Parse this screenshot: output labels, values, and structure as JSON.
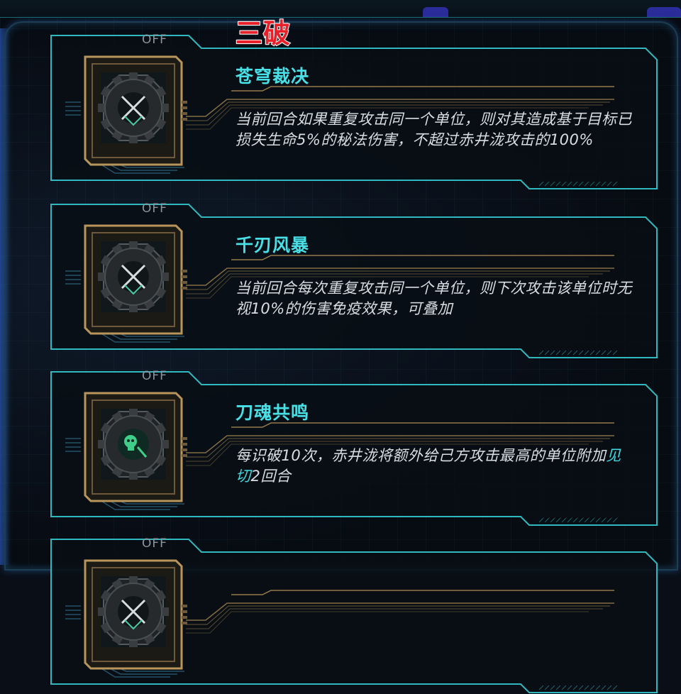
{
  "headline": "三破",
  "skills": [
    {
      "state": "OFF",
      "title": "苍穹裁决",
      "desc": "当前回合如果重复攻击同一个单位，则对其造成基于目标已损失生命5%的秘法伤害，不超过赤井泷攻击的100%",
      "icon": "crossed-swords-gear-icon"
    },
    {
      "state": "OFF",
      "title": "千刃风暴",
      "desc": "当前回合每次重复攻击同一个单位，则下次攻击该单位时无视10%的伤害免疫效果，可叠加",
      "icon": "crossed-swords-gear-icon"
    },
    {
      "state": "OFF",
      "title": "刀魂共鸣",
      "desc_pre": "每识破10次，赤井泷将额外给己方攻击最高的单位附加",
      "desc_highlight": "见切",
      "desc_post": "2回合",
      "icon": "skull-gear-icon"
    },
    {
      "state": "OFF"
    }
  ],
  "colors": {
    "accent_cyan": "#46e0e6",
    "frame_teal": "#2fb8bd",
    "headline_red": "#e8202a",
    "gold": "#b8955a"
  }
}
